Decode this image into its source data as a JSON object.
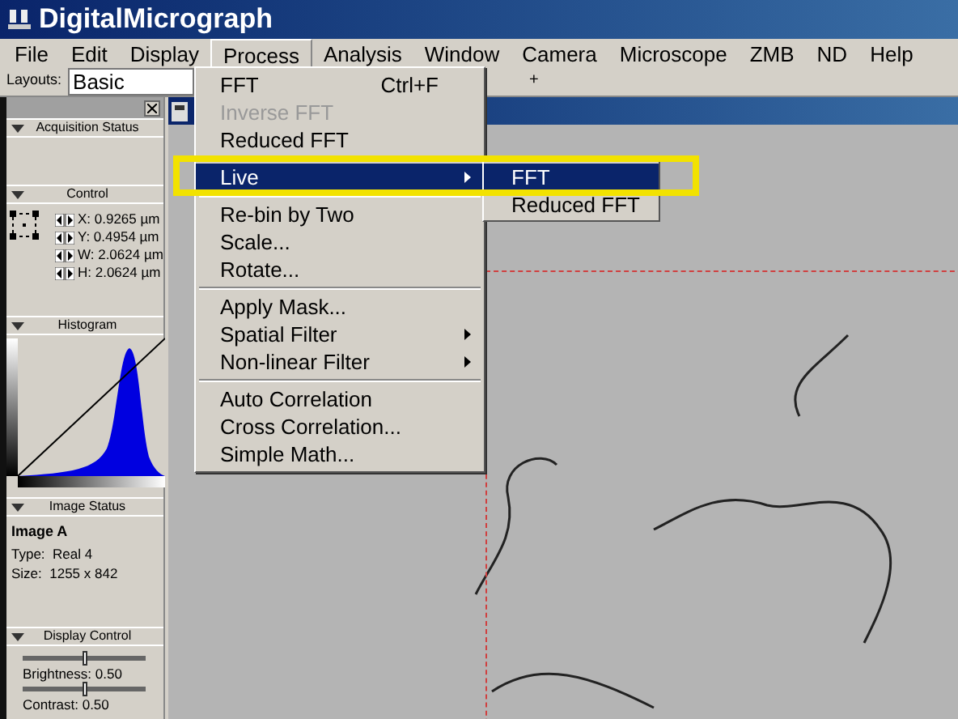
{
  "window": {
    "title": "DigitalMicrograph"
  },
  "menu_bar": [
    {
      "label": "File",
      "selected": false
    },
    {
      "label": "Edit",
      "selected": false
    },
    {
      "label": "Display",
      "selected": false
    },
    {
      "label": "Process",
      "selected": true
    },
    {
      "label": "Analysis",
      "selected": false
    },
    {
      "label": "Window",
      "selected": false
    },
    {
      "label": "Camera",
      "selected": false
    },
    {
      "label": "Microscope",
      "selected": false
    },
    {
      "label": "ZMB",
      "selected": false
    },
    {
      "label": "ND",
      "selected": false
    },
    {
      "label": "Help",
      "selected": false
    }
  ],
  "toolbar": {
    "layouts_label": "Layouts:",
    "layout_value": "Basic",
    "add_button": "+"
  },
  "panels": {
    "acquisition_status": {
      "title": "Acquisition Status"
    },
    "control": {
      "title": "Control",
      "fields": [
        "X: 0.9265 µm",
        "Y: 0.4954 µm",
        "W: 2.0624 µm",
        "H: 2.0624 µm"
      ]
    },
    "histogram": {
      "title": "Histogram"
    },
    "image_status": {
      "title": "Image Status",
      "name": "Image A",
      "lines": [
        "Type:  Real 4",
        "Size:  1255 x 842"
      ]
    },
    "display_control": {
      "title": "Display Control",
      "sliders": [
        {
          "label": "Brightness: 0.50",
          "level": 0.5
        },
        {
          "label": "Contrast: 0.50",
          "level": 0.5
        }
      ]
    }
  },
  "process_menu": [
    {
      "kind": "item",
      "label": "FFT",
      "shortcut": "Ctrl+F",
      "disabled": false,
      "submenu": false,
      "selected": false
    },
    {
      "kind": "item",
      "label": "Inverse FFT",
      "disabled": true,
      "submenu": false,
      "selected": false
    },
    {
      "kind": "item",
      "label": "Reduced FFT",
      "disabled": false,
      "submenu": false,
      "selected": false
    },
    {
      "kind": "separator"
    },
    {
      "kind": "item",
      "label": "Live",
      "disabled": false,
      "submenu": true,
      "selected": true
    },
    {
      "kind": "separator"
    },
    {
      "kind": "item",
      "label": "Re-bin by Two",
      "disabled": false,
      "submenu": false,
      "selected": false
    },
    {
      "kind": "item",
      "label": "Scale...",
      "disabled": false,
      "submenu": false,
      "selected": false
    },
    {
      "kind": "item",
      "label": "Rotate...",
      "disabled": false,
      "submenu": false,
      "selected": false
    },
    {
      "kind": "separator"
    },
    {
      "kind": "item",
      "label": "Apply Mask...",
      "disabled": false,
      "submenu": false,
      "selected": false
    },
    {
      "kind": "item",
      "label": "Spatial Filter",
      "disabled": false,
      "submenu": true,
      "selected": false
    },
    {
      "kind": "item",
      "label": "Non-linear Filter",
      "disabled": false,
      "submenu": true,
      "selected": false
    },
    {
      "kind": "separator"
    },
    {
      "kind": "item",
      "label": "Auto Correlation",
      "disabled": false,
      "submenu": false,
      "selected": false
    },
    {
      "kind": "item",
      "label": "Cross Correlation...",
      "disabled": false,
      "submenu": false,
      "selected": false
    },
    {
      "kind": "item",
      "label": "Simple Math...",
      "disabled": false,
      "submenu": false,
      "selected": false
    }
  ],
  "live_submenu": [
    {
      "label": "FFT",
      "selected": true
    },
    {
      "label": "Reduced FFT",
      "selected": false
    }
  ]
}
